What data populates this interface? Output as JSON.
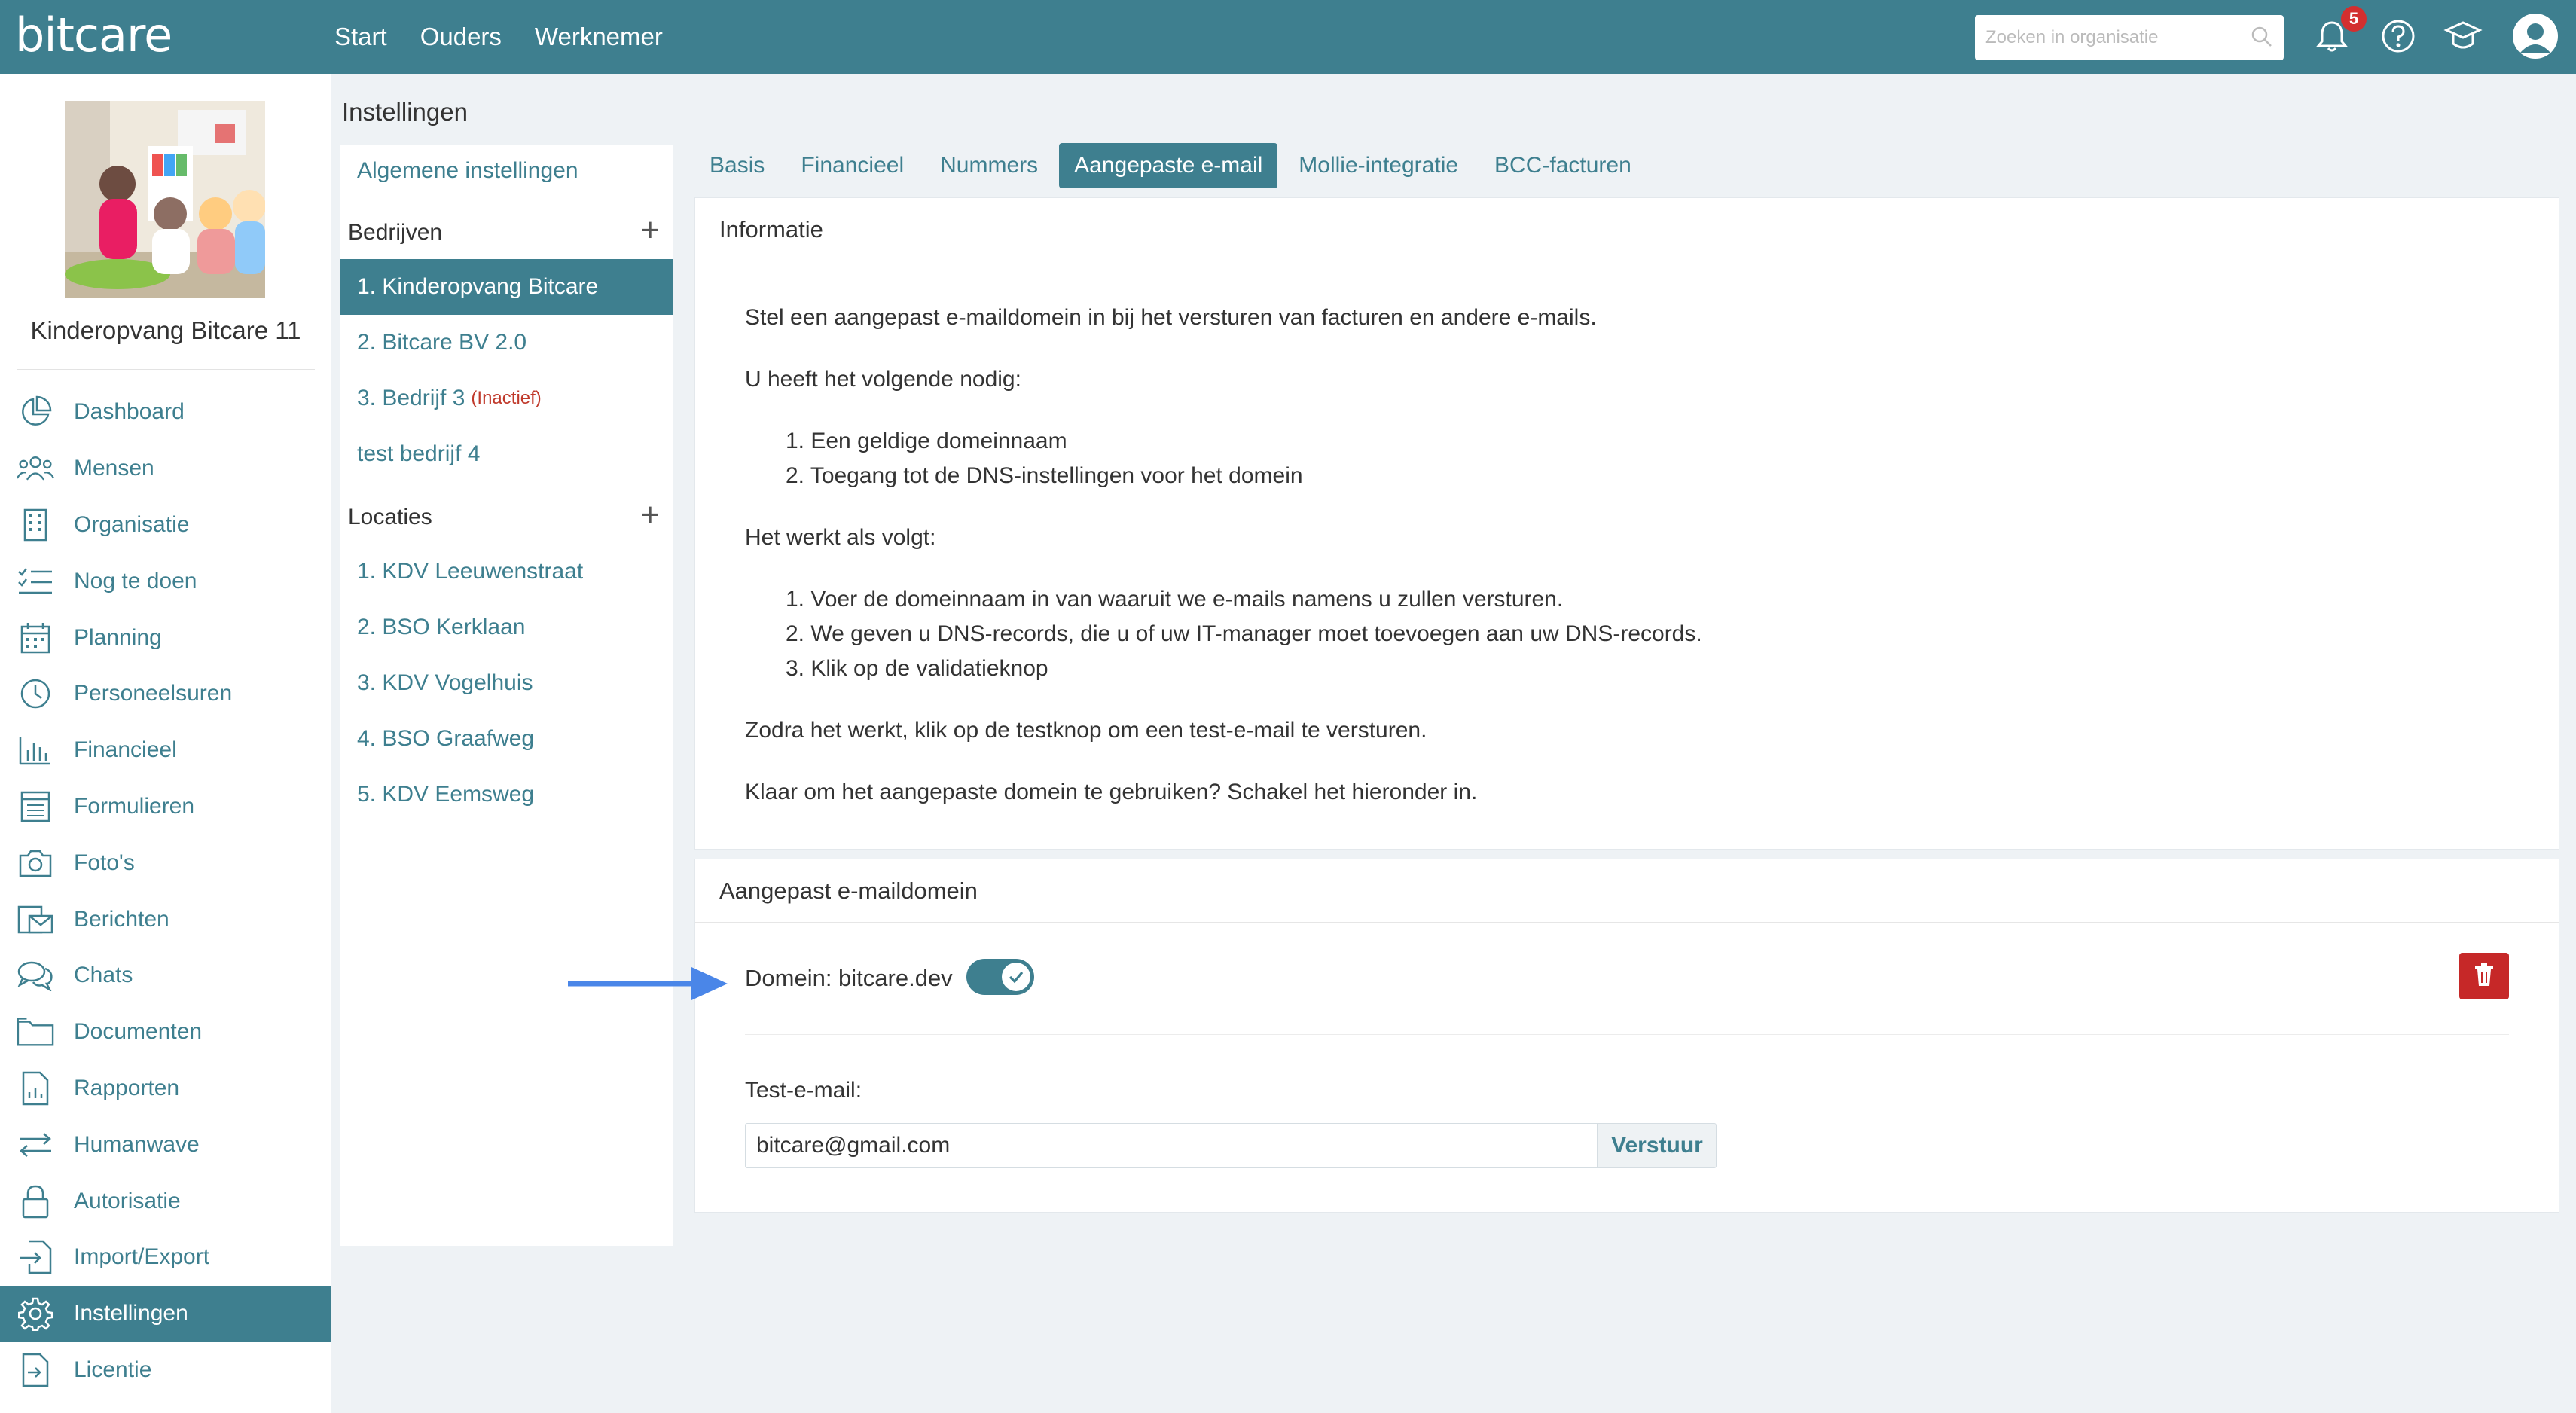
{
  "topbar": {
    "logo": "bitcare",
    "nav": [
      "Start",
      "Ouders",
      "Werknemer"
    ],
    "search_placeholder": "Zoeken in organisatie",
    "notification_count": "5"
  },
  "sidebar": {
    "org_name": "Kinderopvang Bitcare 11",
    "items": [
      {
        "label": "Dashboard",
        "icon": "pie-chart-icon"
      },
      {
        "label": "Mensen",
        "icon": "people-icon"
      },
      {
        "label": "Organisatie",
        "icon": "building-icon"
      },
      {
        "label": "Nog te doen",
        "icon": "checklist-icon"
      },
      {
        "label": "Planning",
        "icon": "calendar-icon"
      },
      {
        "label": "Personeelsuren",
        "icon": "clock-icon"
      },
      {
        "label": "Financieel",
        "icon": "bar-chart-icon"
      },
      {
        "label": "Formulieren",
        "icon": "form-icon"
      },
      {
        "label": "Foto's",
        "icon": "camera-icon"
      },
      {
        "label": "Berichten",
        "icon": "messages-icon"
      },
      {
        "label": "Chats",
        "icon": "chat-icon"
      },
      {
        "label": "Documenten",
        "icon": "folder-icon"
      },
      {
        "label": "Rapporten",
        "icon": "report-icon"
      },
      {
        "label": "Humanwave",
        "icon": "transfer-icon"
      },
      {
        "label": "Autorisatie",
        "icon": "lock-icon"
      },
      {
        "label": "Import/Export",
        "icon": "import-icon"
      },
      {
        "label": "Instellingen",
        "icon": "gear-icon",
        "active": true
      },
      {
        "label": "Licentie",
        "icon": "license-icon"
      }
    ]
  },
  "page": {
    "title": "Instellingen"
  },
  "middle": {
    "general_link": "Algemene instellingen",
    "companies_header": "Bedrijven",
    "companies": [
      {
        "label": "1. Kinderopvang Bitcare",
        "active": true
      },
      {
        "label": "2. Bitcare BV 2.0"
      },
      {
        "label": "3. Bedrijf 3",
        "status": "(Inactief)"
      },
      {
        "label": "test bedrijf 4"
      }
    ],
    "locations_header": "Locaties",
    "locations": [
      "1. KDV Leeuwenstraat",
      "2. BSO Kerklaan",
      "3. KDV Vogelhuis",
      "4. BSO Graafweg",
      "5. KDV Eemsweg"
    ]
  },
  "tabs": [
    {
      "label": "Basis"
    },
    {
      "label": "Financieel"
    },
    {
      "label": "Nummers"
    },
    {
      "label": "Aangepaste e-mail",
      "active": true
    },
    {
      "label": "Mollie-integratie"
    },
    {
      "label": "BCC-facturen"
    }
  ],
  "info_panel": {
    "header": "Informatie",
    "intro": "Stel een aangepast e-maildomein in bij het versturen van facturen en andere e-mails.",
    "needs_title": "U heeft het volgende nodig:",
    "needs": [
      "1. Een geldige domeinnaam",
      "2. Toegang tot de DNS-instellingen voor het domein"
    ],
    "how_title": "Het werkt als volgt:",
    "how": [
      "1. Voer de domeinnaam in van waaruit we e-mails namens u zullen versturen.",
      "2. We geven u DNS-records, die u of uw IT-manager moet toevoegen aan uw DNS-records.",
      "3. Klik op de validatieknop"
    ],
    "test_note": "Zodra het werkt, klik op de testknop om een test-e-mail te versturen.",
    "ready_note": "Klaar om het aangepaste domein te gebruiken? Schakel het hieronder in."
  },
  "domain_panel": {
    "header": "Aangepast e-maildomein",
    "domain_label": "Domein: bitcare.dev",
    "toggle_on": true,
    "test_label": "Test-e-mail:",
    "test_value": "bitcare@gmail.com",
    "send_label": "Verstuur"
  },
  "colors": {
    "primary": "#3e7f8f",
    "danger": "#c62828",
    "arrow": "#4a86e8"
  }
}
